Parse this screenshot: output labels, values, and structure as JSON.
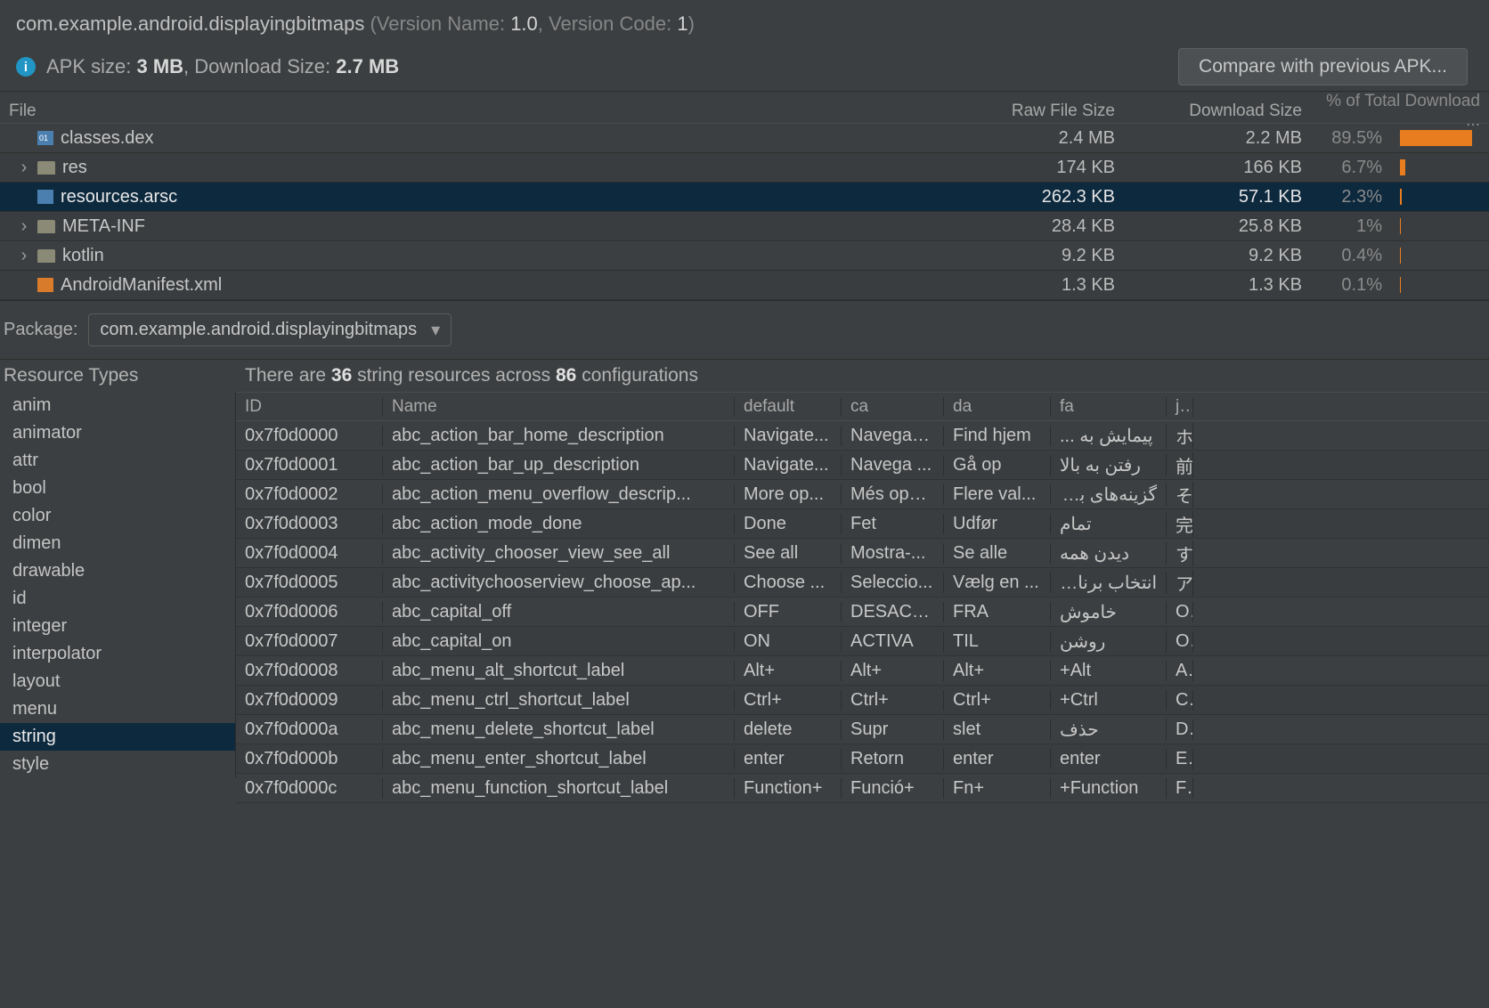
{
  "header": {
    "package": "com.example.android.displayingbitmaps",
    "version_name_label": " (Version Name: ",
    "version_name": "1.0",
    "version_code_label": ", Version Code: ",
    "version_code": "1",
    "close_paren": ")",
    "apk_size_label": "APK size: ",
    "apk_size": "3 MB",
    "download_size_label": ", Download Size: ",
    "download_size": "2.7 MB",
    "compare_button": "Compare with previous APK..."
  },
  "file_table": {
    "columns": {
      "file": "File",
      "raw": "Raw File Size",
      "download": "Download Size",
      "pct": "% of Total Download ..."
    },
    "rows": [
      {
        "name": "classes.dex",
        "icon": "dex",
        "expandable": false,
        "raw": "2.4 MB",
        "download": "2.2 MB",
        "pct": "89.5%",
        "bar": 89.5
      },
      {
        "name": "res",
        "icon": "folder",
        "expandable": true,
        "raw": "174 KB",
        "download": "166 KB",
        "pct": "6.7%",
        "bar": 6.7
      },
      {
        "name": "resources.arsc",
        "icon": "arsc",
        "expandable": false,
        "selected": true,
        "raw": "262.3 KB",
        "download": "57.1 KB",
        "pct": "2.3%",
        "bar": 2.3
      },
      {
        "name": "META-INF",
        "icon": "folder",
        "expandable": true,
        "raw": "28.4 KB",
        "download": "25.8 KB",
        "pct": "1%",
        "bar": 1
      },
      {
        "name": "kotlin",
        "icon": "folder",
        "expandable": true,
        "raw": "9.2 KB",
        "download": "9.2 KB",
        "pct": "0.4%",
        "bar": 0.4
      },
      {
        "name": "AndroidManifest.xml",
        "icon": "xml",
        "expandable": false,
        "raw": "1.3 KB",
        "download": "1.3 KB",
        "pct": "0.1%",
        "bar": 0.1
      }
    ]
  },
  "package_select": {
    "label": "Package:",
    "value": "com.example.android.displayingbitmaps"
  },
  "resource_types": {
    "header": "Resource Types",
    "items": [
      "anim",
      "animator",
      "attr",
      "bool",
      "color",
      "dimen",
      "drawable",
      "id",
      "integer",
      "interpolator",
      "layout",
      "menu",
      "string",
      "style"
    ],
    "selected": "string"
  },
  "strings": {
    "summary_prefix": "There are ",
    "count": "36",
    "summary_mid": " string resources across ",
    "configs": "86",
    "summary_suffix": " configurations",
    "columns": [
      "ID",
      "Name",
      "default",
      "ca",
      "da",
      "fa",
      "ja"
    ],
    "rows": [
      {
        "id": "0x7f0d0000",
        "name": "abc_action_bar_home_description",
        "default": "Navigate...",
        "ca": "Navega f...",
        "da": "Find hjem",
        "fa": "پیمایش به ...",
        "ja": "ホ"
      },
      {
        "id": "0x7f0d0001",
        "name": "abc_action_bar_up_description",
        "default": "Navigate...",
        "ca": "Navega ...",
        "da": "Gå op",
        "fa": "رفتن به بالا",
        "ja": "前"
      },
      {
        "id": "0x7f0d0002",
        "name": "abc_action_menu_overflow_descrip...",
        "default": "More op...",
        "ca": "Més opci...",
        "da": "Flere val...",
        "fa": "گزینه‌های بی...",
        "ja": "そ"
      },
      {
        "id": "0x7f0d0003",
        "name": "abc_action_mode_done",
        "default": "Done",
        "ca": "Fet",
        "da": "Udfør",
        "fa": "تمام",
        "ja": "完"
      },
      {
        "id": "0x7f0d0004",
        "name": "abc_activity_chooser_view_see_all",
        "default": "See all",
        "ca": "Mostra-...",
        "da": "Se alle",
        "fa": "دیدن همه",
        "ja": "す"
      },
      {
        "id": "0x7f0d0005",
        "name": "abc_activitychooserview_choose_ap...",
        "default": "Choose ...",
        "ca": "Seleccio...",
        "da": "Vælg en ...",
        "fa": "انتخاب برنامه",
        "ja": "ア"
      },
      {
        "id": "0x7f0d0006",
        "name": "abc_capital_off",
        "default": "OFF",
        "ca": "DESACTI...",
        "da": "FRA",
        "fa": "خاموش",
        "ja": "OI"
      },
      {
        "id": "0x7f0d0007",
        "name": "abc_capital_on",
        "default": "ON",
        "ca": "ACTIVA",
        "da": "TIL",
        "fa": "روشن",
        "ja": "OI"
      },
      {
        "id": "0x7f0d0008",
        "name": "abc_menu_alt_shortcut_label",
        "default": "Alt+",
        "ca": "Alt+",
        "da": "Alt+",
        "fa": "Alt+",
        "ja": "Al"
      },
      {
        "id": "0x7f0d0009",
        "name": "abc_menu_ctrl_shortcut_label",
        "default": "Ctrl+",
        "ca": "Ctrl+",
        "da": "Ctrl+",
        "fa": "Ctrl+",
        "ja": "Ct"
      },
      {
        "id": "0x7f0d000a",
        "name": "abc_menu_delete_shortcut_label",
        "default": "delete",
        "ca": "Supr",
        "da": "slet",
        "fa": "حذف",
        "ja": "De"
      },
      {
        "id": "0x7f0d000b",
        "name": "abc_menu_enter_shortcut_label",
        "default": "enter",
        "ca": "Retorn",
        "da": "enter",
        "fa": "enter",
        "ja": "Er"
      },
      {
        "id": "0x7f0d000c",
        "name": "abc_menu_function_shortcut_label",
        "default": "Function+",
        "ca": "Funció+",
        "da": "Fn+",
        "fa": "Function+",
        "ja": "Fu"
      }
    ]
  }
}
